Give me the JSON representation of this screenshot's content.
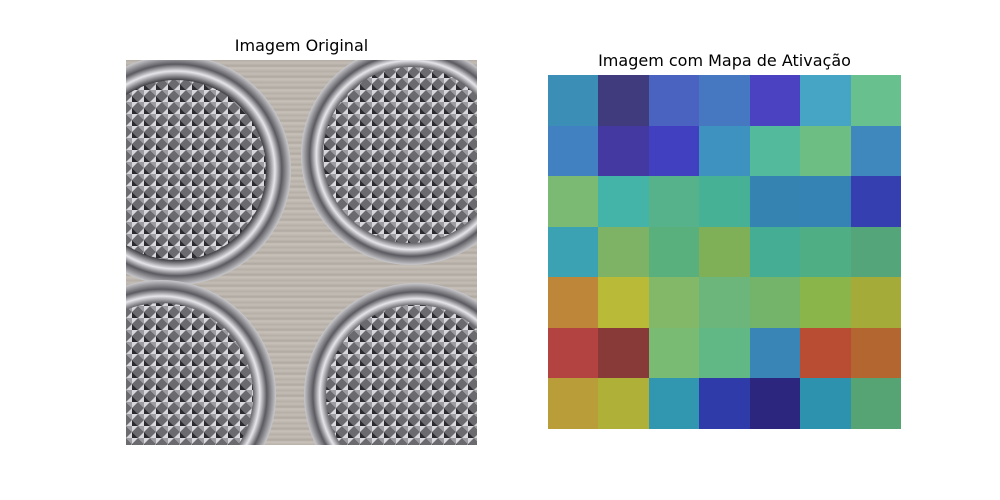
{
  "left_panel": {
    "title": "Imagem Original",
    "image_description_icon": "metal-tactile-studs-photo"
  },
  "right_panel": {
    "title": "Imagem com Mapa de Ativação",
    "grid_rows": 7,
    "grid_cols": 7,
    "cell_colors": [
      [
        "#3b8fb6",
        "#3f3b7c",
        "#4a62c0",
        "#4578c0",
        "#4b42c2",
        "#46a4c4",
        "#68c08f"
      ],
      [
        "#4281c1",
        "#4339a1",
        "#4040c1",
        "#3d92bf",
        "#53ba9c",
        "#6cbe83",
        "#3f88be"
      ],
      [
        "#7aba73",
        "#45b4a8",
        "#56b28a",
        "#47b196",
        "#3583b1",
        "#3582b5",
        "#363fb0"
      ],
      [
        "#3ba2b3",
        "#7eb366",
        "#59b07d",
        "#7faf57",
        "#45ad93",
        "#50ae85",
        "#54a67a"
      ],
      [
        "#bd8638",
        "#b9bb38",
        "#82b868",
        "#6cb67b",
        "#74b46a",
        "#8ab54a",
        "#a4ab38"
      ],
      [
        "#b34340",
        "#883a39",
        "#79bb72",
        "#62b884",
        "#3985b5",
        "#b84d33",
        "#b3662f"
      ],
      [
        "#b99d38",
        "#aeb038",
        "#3196b0",
        "#2f3ba8",
        "#2c267f",
        "#2c92ad",
        "#56a473"
      ]
    ]
  },
  "colors": {
    "background": "#ffffff",
    "text": "#000000"
  }
}
